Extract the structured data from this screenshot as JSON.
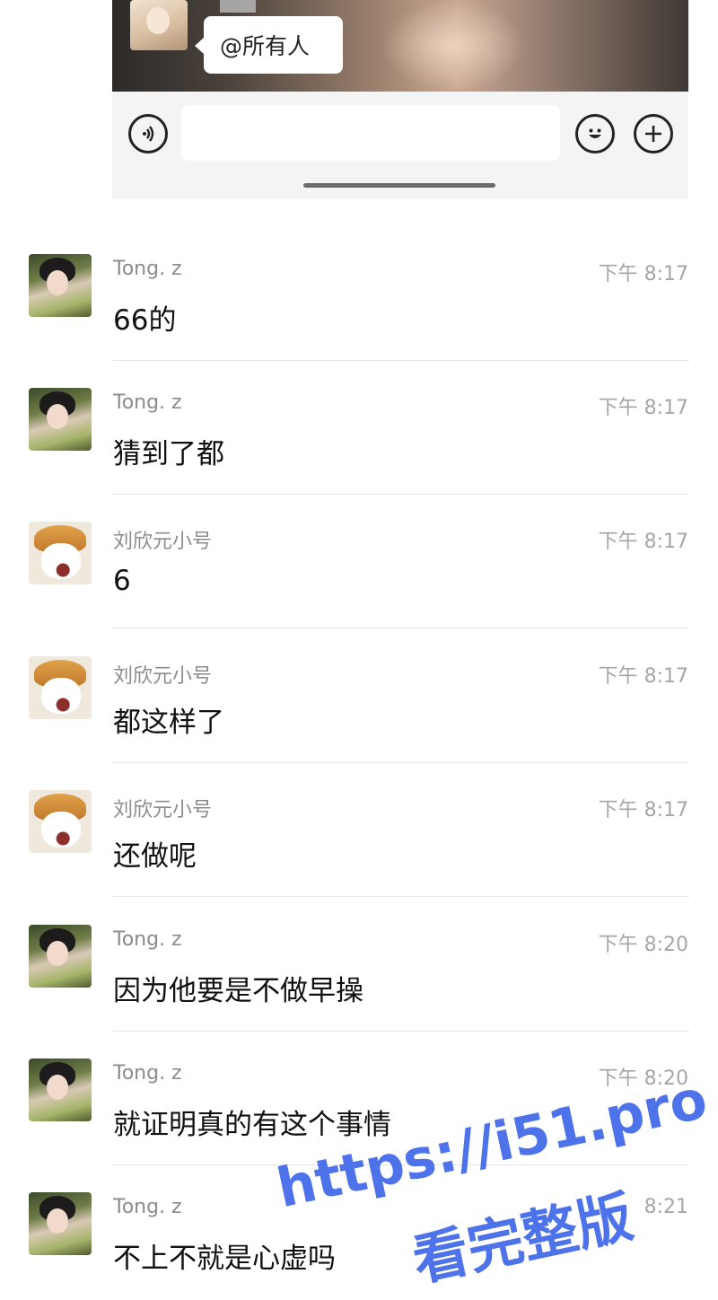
{
  "embedded_chat": {
    "mention_text": "@所有人",
    "input_placeholder": ""
  },
  "icons": {
    "voice": "voice-icon",
    "emoji": "emoji-icon",
    "plus": "plus-icon"
  },
  "messages": [
    {
      "sender": "Tong. z",
      "time": "下午 8:17",
      "text": "66的",
      "avatar": "girl"
    },
    {
      "sender": "Tong. z",
      "time": "下午 8:17",
      "text": "猜到了都",
      "avatar": "girl"
    },
    {
      "sender": "刘欣元小号",
      "time": "下午 8:17",
      "text": "6",
      "avatar": "dog"
    },
    {
      "sender": "刘欣元小号",
      "time": "下午 8:17",
      "text": "都这样了",
      "avatar": "dog"
    },
    {
      "sender": "刘欣元小号",
      "time": "下午 8:17",
      "text": "还做呢",
      "avatar": "dog"
    },
    {
      "sender": "Tong. z",
      "time": "下午 8:20",
      "text": "因为他要是不做早操",
      "avatar": "girl"
    },
    {
      "sender": "Tong. z",
      "time": "下午 8:20",
      "text": "就证明真的有这个事情",
      "avatar": "girl"
    },
    {
      "sender": "Tong. z",
      "time": "8:21",
      "text": "不上不就是心虚吗",
      "avatar": "girl"
    }
  ],
  "watermark": {
    "line1": "https://i51.pro",
    "line2": "看完整版",
    "color": "#3a63e8"
  }
}
